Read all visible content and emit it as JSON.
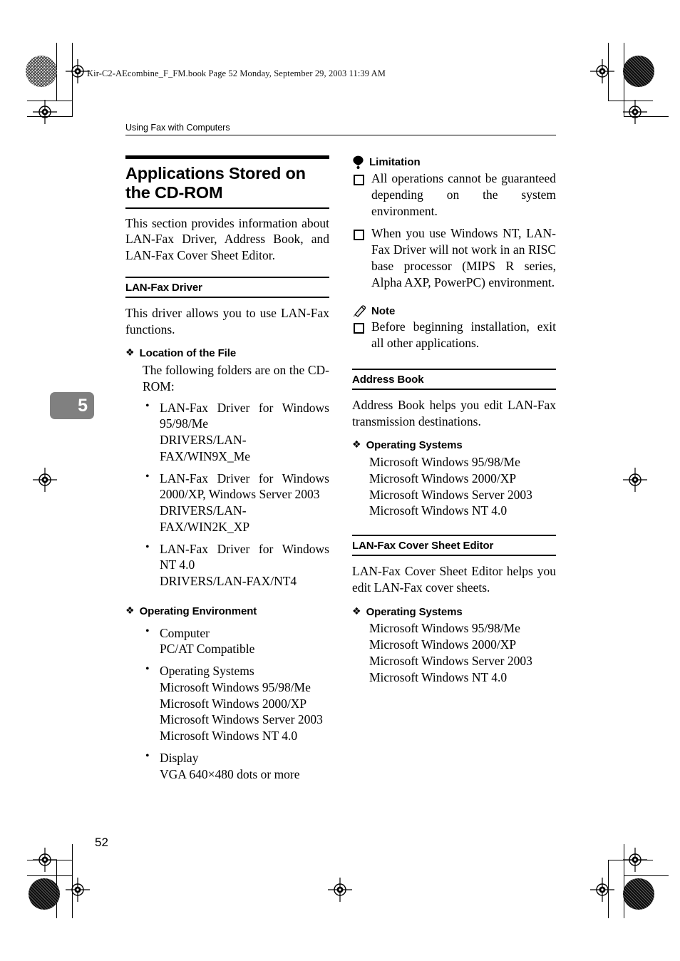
{
  "slug": "Kir-C2-AEcombine_F_FM.book  Page 52  Monday, September 29, 2003  11:39 AM",
  "running_head": "Using Fax with Computers",
  "chapter_tab": "5",
  "folio": "52",
  "left_column": {
    "title": "Applications Stored on the CD-ROM",
    "intro": "This section provides information about LAN-Fax Driver, Address Book, and LAN-Fax Cover Sheet Editor.",
    "section": {
      "heading": "LAN-Fax Driver",
      "body": "This driver allows you to use LAN-Fax functions.",
      "location": {
        "heading": "Location of the File",
        "lead": "The following folders are on the CD-ROM:",
        "items": [
          {
            "name": "LAN-Fax Driver for Windows 95/98/Me",
            "path": "DRIVERS/LAN-FAX/WIN9X_Me"
          },
          {
            "name": "LAN-Fax Driver for Windows 2000/XP, Windows Server 2003",
            "path": "DRIVERS/LAN-FAX/WIN2K_XP"
          },
          {
            "name": "LAN-Fax Driver for Windows NT 4.0",
            "path": "DRIVERS/LAN-FAX/NT4"
          }
        ]
      },
      "environment": {
        "heading": "Operating Environment",
        "items": [
          {
            "label": "Computer",
            "lines": [
              "PC/AT Compatible"
            ]
          },
          {
            "label": "Operating Systems",
            "lines": [
              "Microsoft Windows 95/98/Me",
              "Microsoft Windows 2000/XP",
              "Microsoft Windows Server 2003",
              "Microsoft Windows NT 4.0"
            ]
          },
          {
            "label": "Display",
            "lines": [
              "VGA 640×480 dots or more"
            ]
          }
        ]
      }
    }
  },
  "right_column": {
    "limitation": {
      "icon": "limitation-icon",
      "label": "Limitation",
      "items": [
        "All operations cannot be guaranteed depending on the system environment.",
        "When you use Windows NT, LAN-Fax Driver will not work in an RISC base processor (MIPS R series, Alpha AXP, PowerPC) environment."
      ]
    },
    "note": {
      "icon": "note-pencil-icon",
      "label": "Note",
      "items": [
        "Before beginning installation, exit all other applications."
      ]
    },
    "address_book": {
      "heading": "Address Book",
      "body": "Address Book helps you edit LAN-Fax transmission destinations.",
      "os": {
        "heading": "Operating Systems",
        "lines": [
          "Microsoft Windows 95/98/Me",
          "Microsoft Windows 2000/XP",
          "Microsoft Windows Server 2003",
          "Microsoft Windows NT 4.0"
        ]
      }
    },
    "cover_sheet_editor": {
      "heading": "LAN-Fax Cover Sheet Editor",
      "body": "LAN-Fax Cover Sheet Editor helps you edit LAN-Fax cover sheets.",
      "os": {
        "heading": "Operating Systems",
        "lines": [
          "Microsoft Windows 95/98/Me",
          "Microsoft Windows 2000/XP",
          "Microsoft Windows Server 2003",
          "Microsoft Windows NT 4.0"
        ]
      }
    }
  },
  "glyphs": {
    "diamond": "❖"
  }
}
